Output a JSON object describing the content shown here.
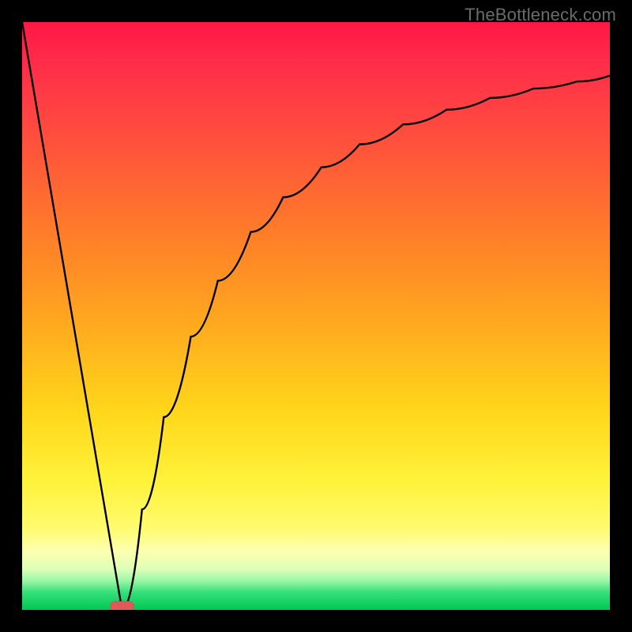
{
  "attribution": "TheBottleneck.com",
  "chart_data": {
    "type": "line",
    "title": "",
    "xlabel": "",
    "ylabel": "",
    "xlim": [
      0,
      100
    ],
    "ylim": [
      0,
      100
    ],
    "notes": "Background is a vertical gradient from red (top, high bottleneck) through orange/yellow to green (bottom, optimal). The black curve forms a V with minimum near x≈17 at the bottom, and the right branch asymptotically rises toward the top-right. A small red rounded marker sits at the V's minimum.",
    "series": [
      {
        "name": "left-branch",
        "x": [
          0,
          17
        ],
        "y": [
          100,
          0
        ]
      },
      {
        "name": "right-branch",
        "x": [
          17,
          20.4,
          24.1,
          28.7,
          33.3,
          38.9,
          44.4,
          50.9,
          57.4,
          64.8,
          72.2,
          79.6,
          87.0,
          94.4,
          100.0
        ],
        "y": [
          0,
          17.1,
          32.8,
          46.5,
          56.0,
          64.3,
          70.2,
          75.3,
          79.2,
          82.6,
          85.1,
          87.1,
          88.7,
          89.9,
          90.9
        ]
      }
    ],
    "marker": {
      "x": 17,
      "y": 0,
      "color": "#e05a5a"
    },
    "gradient_colors": {
      "top": "#ff1744",
      "mid_upper": "#ff7a2a",
      "mid": "#ffd61a",
      "mid_lower": "#fffb6e",
      "bottom": "#00c853"
    }
  }
}
